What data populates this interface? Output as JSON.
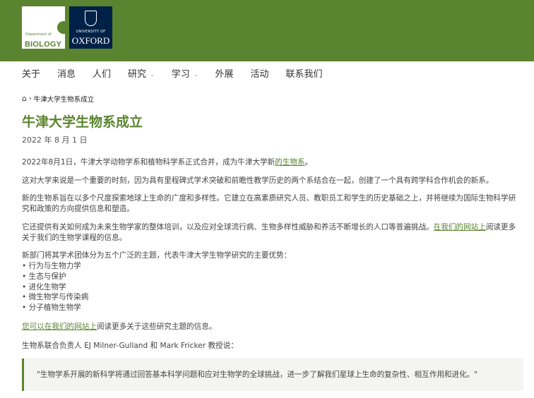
{
  "header": {
    "dept_logo": {
      "line1": "Department of",
      "line2": "BIOLOGY"
    },
    "oxford_logo": {
      "line1": "UNIVERSITY OF",
      "line2": "OXFORD"
    }
  },
  "nav": [
    {
      "label": "关于",
      "has_dropdown": false
    },
    {
      "label": "消息",
      "has_dropdown": false
    },
    {
      "label": "人们",
      "has_dropdown": false
    },
    {
      "label": "研究",
      "has_dropdown": true
    },
    {
      "label": "学习",
      "has_dropdown": true
    },
    {
      "label": "外展",
      "has_dropdown": false
    },
    {
      "label": "活动",
      "has_dropdown": false
    },
    {
      "label": "联系我们",
      "has_dropdown": false
    }
  ],
  "breadcrumb": {
    "home_icon": "home-icon",
    "separator": "›",
    "current": "牛津大学生物系成立"
  },
  "article": {
    "title": "牛津大学生物系成立",
    "date": "2022 年 8 月 1 日",
    "p1_text": "2022年8月1日，牛津大学动物学系和植物科学系正式合并，成为牛津大学新",
    "p1_link": "的生物系",
    "p1_end": "。",
    "p2": "这对大学来说是一个重要的时刻，因为具有里程碑式学术突破和前瞻性教学历史的两个系结合在一起，创建了一个具有跨学科合作机会的新系。",
    "p3_line1": "新的生物系旨在以多个尺度探索地球上生命的广度和多样性。它建立在高素质研究人员、教职员工和学生的历史基础之上，并将继续为国际生物科学研",
    "p3_line2": "究和政策的方向提供信息和塑造。",
    "p4_text": "它还提供有关如何成为未来生物学家的整体培训，以及应对全球流行病、生物多样性威胁和养活不断增长的人口等普遍挑战。",
    "p4_link": "在我们的网站上",
    "p4_line1_end": "阅读更多",
    "p4_line2": "关于我们的生物学课程的信息。",
    "p5_intro": "新部门将其学术团体分为五个广泛的主题，代表牛津大学生物学研究的主要优势：",
    "themes": [
      "• 行为与生物力学",
      "• 生态与保护",
      "• 进化生物学",
      "• 微生物学与传染病",
      "• 分子植物生物学"
    ],
    "p6_link": "您可以在我们的网站上",
    "p6_text": "阅读更多关于这些研究主题的信息。",
    "p7": "生物系联合负责人 EJ Milner-Gulland 和 Mark Fricker 教授说：",
    "quote": "\"生物学系开展的新科学将通过回答基本科学问题和应对生物学的全球挑战，进一步了解我们星球上生命的复杂性、相互作用和进化。\""
  },
  "colors": {
    "brand_green": "#5b8430",
    "oxford_blue": "#002147",
    "quote_bg": "#f4f4f1"
  }
}
